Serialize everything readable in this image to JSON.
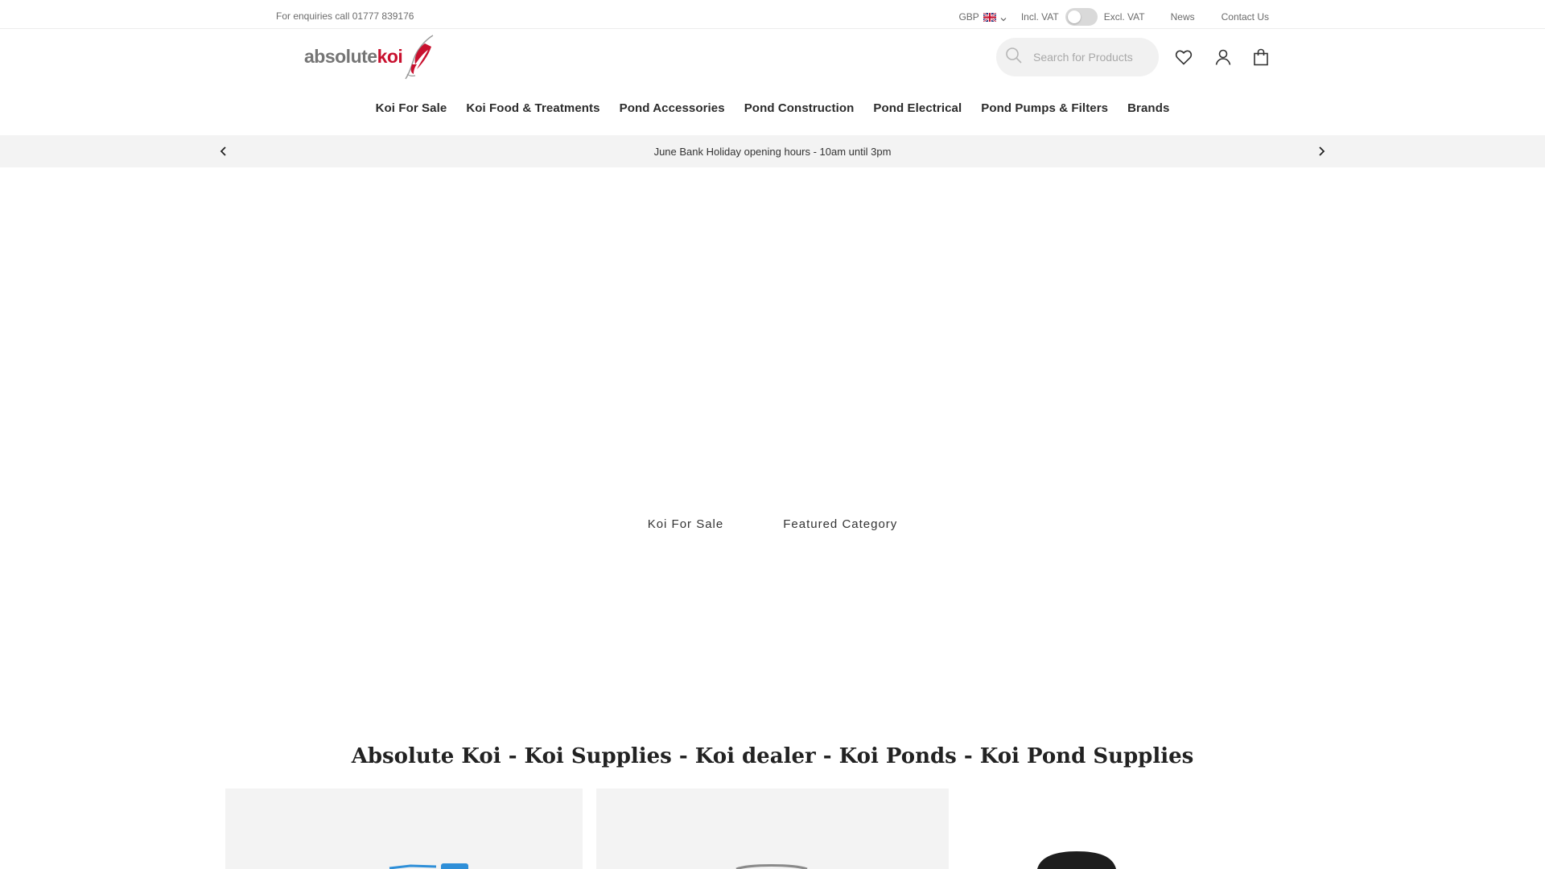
{
  "topbar": {
    "enquiries": "For enquiries call 01777 839176",
    "currency": "GBP",
    "incl_vat": "Incl. VAT",
    "excl_vat": "Excl. VAT",
    "links": [
      "News",
      "Contact Us"
    ]
  },
  "header": {
    "logo_part1": "absolute",
    "logo_part2": "koi",
    "search_placeholder": "Search for Products",
    "icons": [
      "search-icon",
      "heart-icon",
      "user-icon",
      "bag-icon"
    ]
  },
  "nav": {
    "items": [
      "Koi For Sale",
      "Koi Food & Treatments",
      "Pond Accessories",
      "Pond Construction",
      "Pond Electrical",
      "Pond Pumps & Filters",
      "Brands"
    ]
  },
  "announcement": {
    "text": "June Bank Holiday opening hours - 10am until 3pm"
  },
  "hero": {
    "tabs": [
      "Koi For Sale",
      "Featured Category"
    ]
  },
  "main": {
    "title": "Absolute Koi - Koi Supplies - Koi dealer - Koi Ponds - Koi Pond Supplies"
  },
  "colors": {
    "brand_red": "#c8102e",
    "banner_bg": "#f3f3f3"
  }
}
